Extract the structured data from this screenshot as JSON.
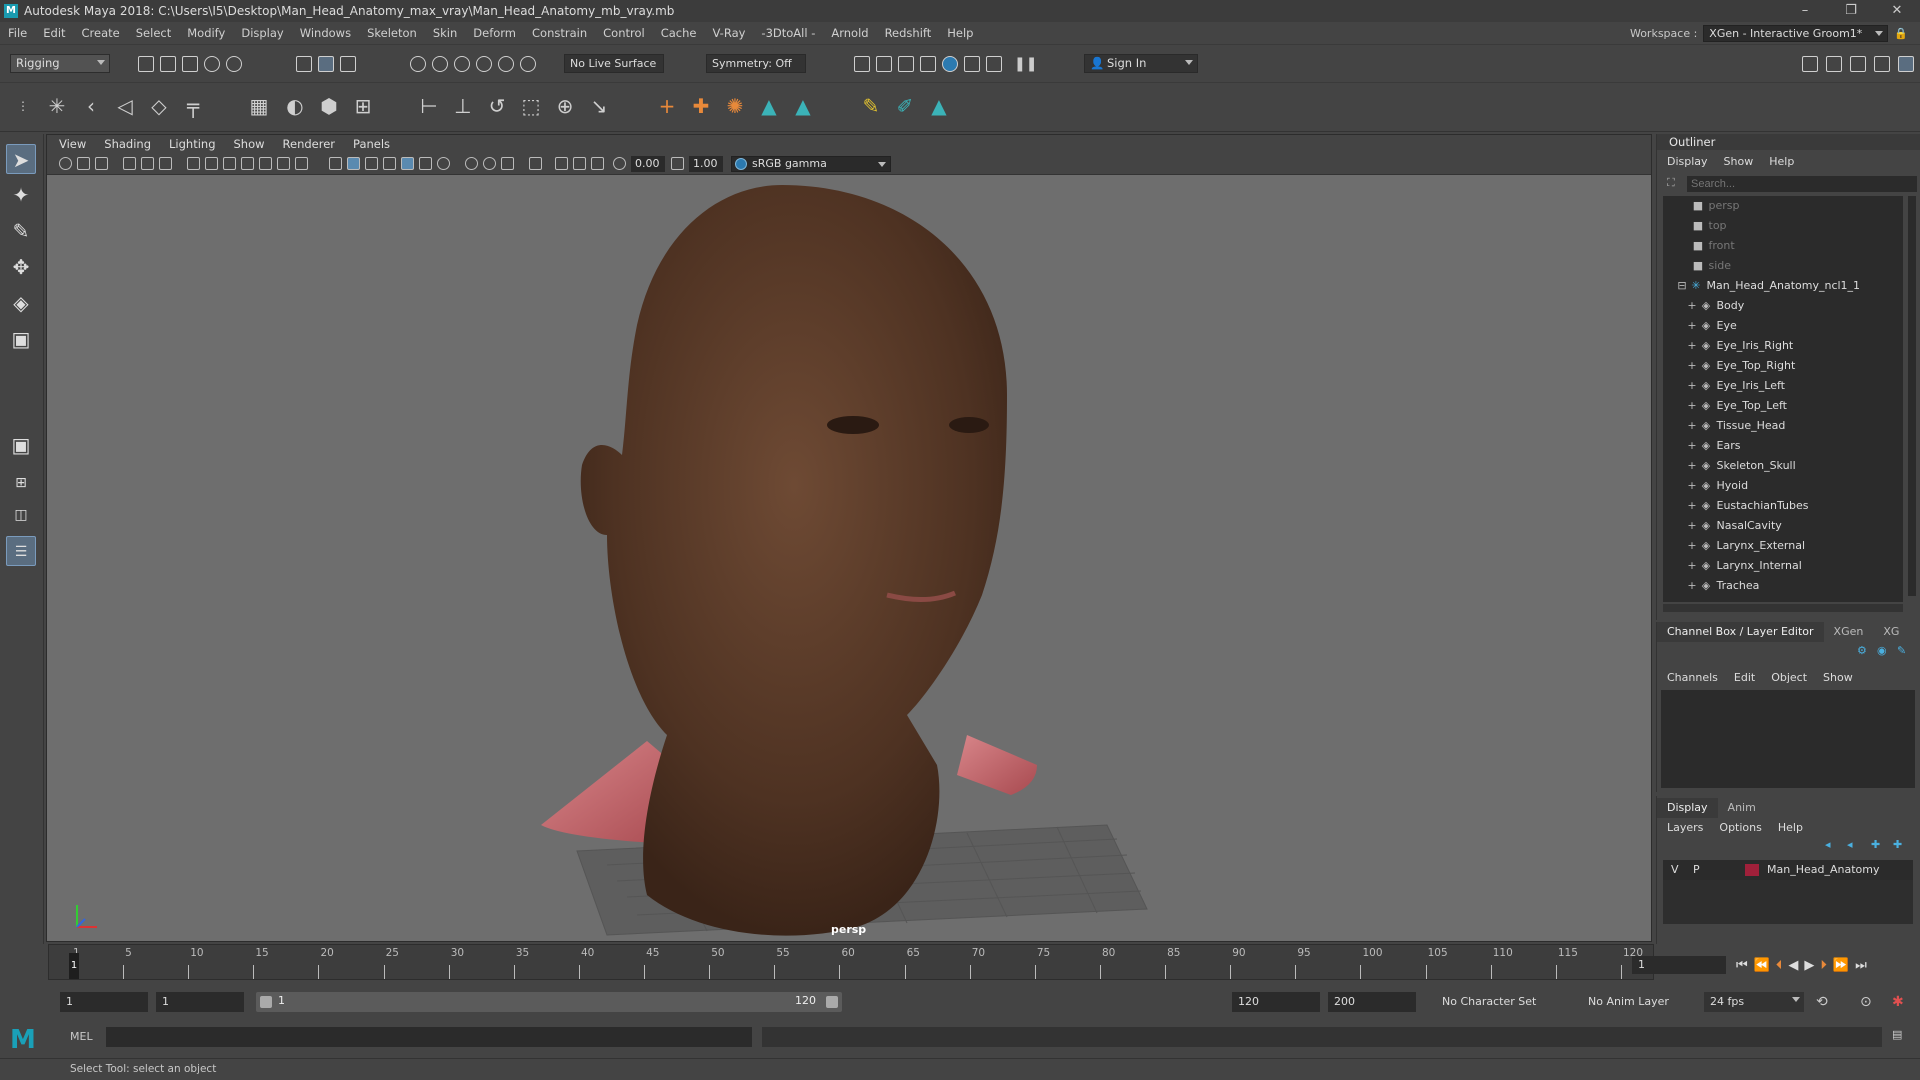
{
  "window": {
    "title": "Autodesk Maya 2018: C:\\Users\\I5\\Desktop\\Man_Head_Anatomy_max_vray\\Man_Head_Anatomy_mb_vray.mb",
    "logo": "M"
  },
  "menubar": {
    "items": [
      "File",
      "Edit",
      "Create",
      "Select",
      "Modify",
      "Display",
      "Windows",
      "Skeleton",
      "Skin",
      "Deform",
      "Constrain",
      "Control",
      "Cache",
      "V-Ray",
      "-3DtoAll -",
      "Arnold",
      "Redshift",
      "Help"
    ],
    "workspace_label": "Workspace :",
    "workspace_value": "XGen - Interactive Groom1*"
  },
  "statusline": {
    "mode": "Rigging",
    "live_surface": "No Live Surface",
    "symmetry": "Symmetry: Off",
    "sign_in": "Sign In"
  },
  "viewport": {
    "menu": [
      "View",
      "Shading",
      "Lighting",
      "Show",
      "Renderer",
      "Panels"
    ],
    "exposure": "0.00",
    "gamma_value": "1.00",
    "color_space": "sRGB gamma",
    "camera_label": "persp"
  },
  "timeline": {
    "ticks": [
      "1",
      "5",
      "10",
      "15",
      "20",
      "25",
      "30",
      "35",
      "40",
      "45",
      "50",
      "55",
      "60",
      "65",
      "70",
      "75",
      "80",
      "85",
      "90",
      "95",
      "100",
      "105",
      "110",
      "115",
      "120"
    ],
    "current_frame": "1",
    "current_frame_field": "1"
  },
  "range": {
    "start": "1",
    "playback_start": "1",
    "slider_start": "1",
    "slider_end": "120",
    "playback_end": "120",
    "end": "200",
    "character_set": "No Character Set",
    "anim_layer": "No Anim Layer",
    "fps": "24 fps"
  },
  "mel": {
    "label": "MEL"
  },
  "helpline": {
    "text": "Select Tool: select an object"
  },
  "outliner": {
    "title": "Outliner",
    "menu": [
      "Display",
      "Show",
      "Help"
    ],
    "search_placeholder": "Search...",
    "cameras": [
      "persp",
      "top",
      "front",
      "side"
    ],
    "group": "Man_Head_Anatomy_ncl1_1",
    "children": [
      "Body",
      "Eye",
      "Eye_Iris_Right",
      "Eye_Top_Right",
      "Eye_Iris_Left",
      "Eye_Top_Left",
      "Tissue_Head",
      "Ears",
      "Skeleton_Skull",
      "Hyoid",
      "EustachianTubes",
      "NasalCavity",
      "Larynx_External",
      "Larynx_Internal",
      "Trachea"
    ]
  },
  "channelbox": {
    "tabs": [
      "Channel Box / Layer Editor",
      "XGen",
      "XG"
    ],
    "menu": [
      "Channels",
      "Edit",
      "Object",
      "Show"
    ]
  },
  "layers": {
    "tabs": [
      "Display",
      "Anim"
    ],
    "menu": [
      "Layers",
      "Options",
      "Help"
    ],
    "layer": {
      "v": "V",
      "p": "P",
      "name": "Man_Head_Anatomy",
      "color": "#a0203a"
    }
  }
}
